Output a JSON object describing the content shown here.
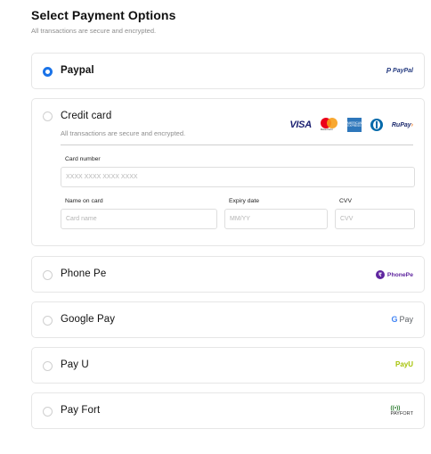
{
  "header": {
    "title": "Select Payment Options",
    "subtitle": "All transactions are secure and encrypted."
  },
  "options": [
    {
      "id": "paypal",
      "label": "Paypal",
      "selected": true,
      "logo_text": "PayPal"
    },
    {
      "id": "credit-card",
      "label": "Credit card",
      "selected": false,
      "subtitle": "All transactions are secure and encrypted.",
      "card_brands": [
        "VISA",
        "MasterCard",
        "AMERICAN EXPRESS",
        "Diners Club",
        "RuPay"
      ]
    },
    {
      "id": "phonepe",
      "label": "Phone Pe",
      "selected": false,
      "logo_text": "PhonePe"
    },
    {
      "id": "googlepay",
      "label": "Google Pay",
      "selected": false,
      "logo_text": "Pay"
    },
    {
      "id": "payu",
      "label": "Pay U",
      "selected": false,
      "logo_text": "PayU"
    },
    {
      "id": "payfort",
      "label": "Pay Fort",
      "selected": false,
      "logo_text": "PAYFORT"
    }
  ],
  "card_form": {
    "card_number": {
      "label": "Card number",
      "placeholder": "XXXX XXXX XXXX XXXX"
    },
    "name_on_card": {
      "label": "Name on card",
      "placeholder": "Card name"
    },
    "expiry": {
      "label": "Expiry date",
      "placeholder": "MM/YY"
    },
    "cvv": {
      "label": "CVV",
      "placeholder": "CVV"
    }
  },
  "colors": {
    "accent": "#1a73e8",
    "border": "#e6e6e6",
    "muted_text": "#8d8d8d"
  }
}
